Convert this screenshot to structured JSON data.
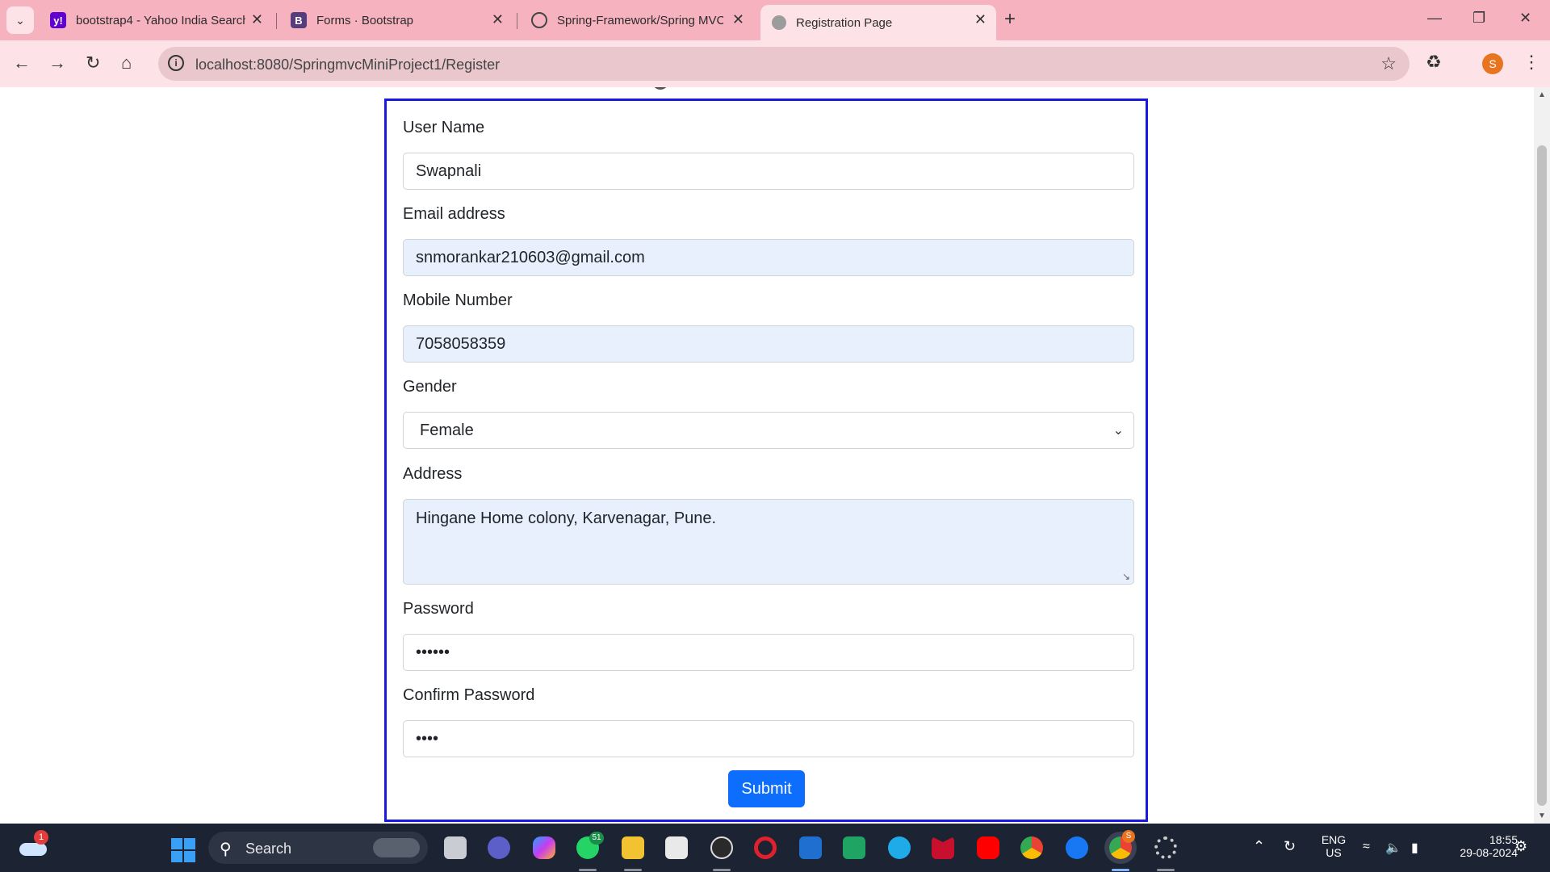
{
  "browser": {
    "tabs": [
      {
        "title": "bootstrap4 - Yahoo India Search",
        "favicon": "yahoo-icon",
        "active": false
      },
      {
        "title": "Forms · Bootstrap",
        "favicon": "bootstrap-icon",
        "active": false
      },
      {
        "title": "Spring-Framework/Spring MVC",
        "favicon": "github-icon",
        "active": false
      },
      {
        "title": "Registration Page",
        "favicon": "globe-icon",
        "active": true
      }
    ],
    "url": "localhost:8080/SpringmvcMiniProject1/Register",
    "profile_initial": "S"
  },
  "form": {
    "username_label": "User Name",
    "username_value": "Swapnali",
    "email_label": "Email address",
    "email_value": "snmorankar210603@gmail.com",
    "mobile_label": "Mobile Number",
    "mobile_value": "7058058359",
    "gender_label": "Gender",
    "gender_value": "Female",
    "address_label": "Address",
    "address_value": "Hingane Home colony, Karvenagar, Pune.",
    "password_label": "Password",
    "password_value": "••••••",
    "confirm_label": "Confirm Password",
    "confirm_value": "••••",
    "submit_label": "Submit"
  },
  "taskbar": {
    "weather_badge": "1",
    "search_label": "Search",
    "whatsapp_badge": "51",
    "chrome_badge": "S",
    "lang_top": "ENG",
    "lang_bottom": "US",
    "time": "18:55",
    "date": "29-08-2024"
  },
  "colors": {
    "tabbar": "#f7b2c0",
    "toolbar": "#fde3e8",
    "form_border": "#1a1adf",
    "autofill": "#e8f0fe",
    "submit": "#0d6efd",
    "taskbar": "#1c2333"
  }
}
